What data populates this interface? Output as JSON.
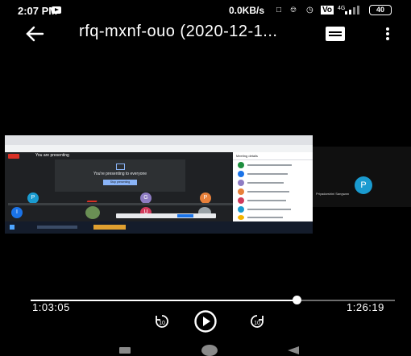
{
  "status_bar": {
    "time": "2:07 PM",
    "net_speed": "0.0KB/s",
    "volte_badge": "Vo",
    "signal_label": "4G",
    "battery": "40"
  },
  "app_bar": {
    "title": "rfq-mxnf-ouo (2020-12-1..."
  },
  "video": {
    "meet_banner": "You are presenting",
    "presenting_message": "You're presenting to everyone",
    "stop_presenting_label": "Stop presenting",
    "people_panel_title": "Meeting details",
    "participant_side_initial": "P",
    "participant_side_name": "Priyadarshini Sangwan",
    "bottom_tiles": [
      {
        "initial": "P",
        "color": "#1a9bd0"
      },
      {
        "initial": "G",
        "color": "#8e7cc3"
      },
      {
        "initial": "P",
        "color": "#e8803a"
      },
      {
        "initial": "I",
        "color": "#1a73e8"
      },
      {
        "initial": "U",
        "color": "#d13b5c"
      }
    ]
  },
  "player": {
    "current_time": "1:03:05",
    "total_time": "1:26:19",
    "progress": 0.731
  },
  "icons": {
    "back": "arrow-left-icon",
    "subtitles": "subtitles-icon",
    "more": "more-vert-icon",
    "rewind": "replay-10-icon",
    "play": "play-icon",
    "forward": "forward-10-icon"
  }
}
